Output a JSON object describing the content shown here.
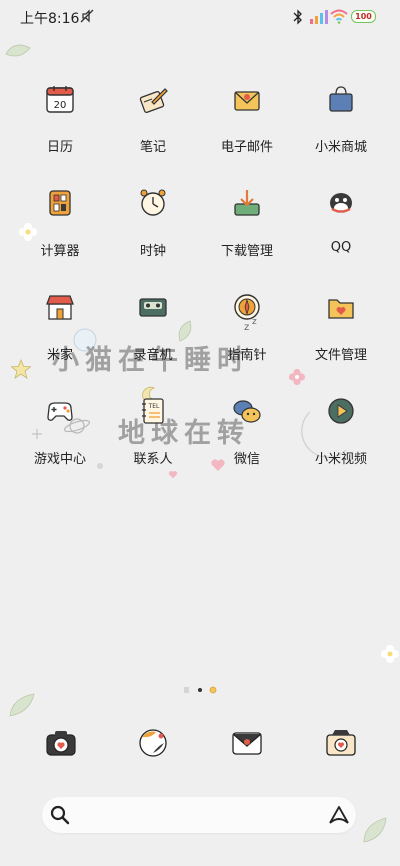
{
  "status": {
    "time": "上午8:16",
    "battery": "100"
  },
  "apps": [
    {
      "label": "日历",
      "icon": "calendar-icon",
      "day": "20"
    },
    {
      "label": "笔记",
      "icon": "notes-icon"
    },
    {
      "label": "电子邮件",
      "icon": "email-icon"
    },
    {
      "label": "小米商城",
      "icon": "shopping-bag-icon"
    },
    {
      "label": "计算器",
      "icon": "calculator-icon"
    },
    {
      "label": "时钟",
      "icon": "alarm-clock-icon"
    },
    {
      "label": "下载管理",
      "icon": "download-icon"
    },
    {
      "label": "QQ",
      "icon": "qq-penguin-icon"
    },
    {
      "label": "米家",
      "icon": "home-shop-icon"
    },
    {
      "label": "录音机",
      "icon": "cassette-recorder-icon"
    },
    {
      "label": "指南针",
      "icon": "compass-icon"
    },
    {
      "label": "文件管理",
      "icon": "folder-icon"
    },
    {
      "label": "游戏中心",
      "icon": "gamepad-icon"
    },
    {
      "label": "联系人",
      "icon": "contacts-book-icon",
      "tag": "TEL"
    },
    {
      "label": "微信",
      "icon": "wechat-bubbles-icon"
    },
    {
      "label": "小米视频",
      "icon": "video-play-icon"
    }
  ],
  "wallpaper_text": {
    "line1": "小猫在午睡时",
    "line2": "地球在转"
  },
  "dock": [
    "camera-icon",
    "browser-cat-icon",
    "messages-envelope-icon",
    "photo-camera-icon"
  ],
  "colors": {
    "background": "#efefef",
    "accent": "#f0a23a",
    "icon_dark": "#3a3a3a"
  }
}
